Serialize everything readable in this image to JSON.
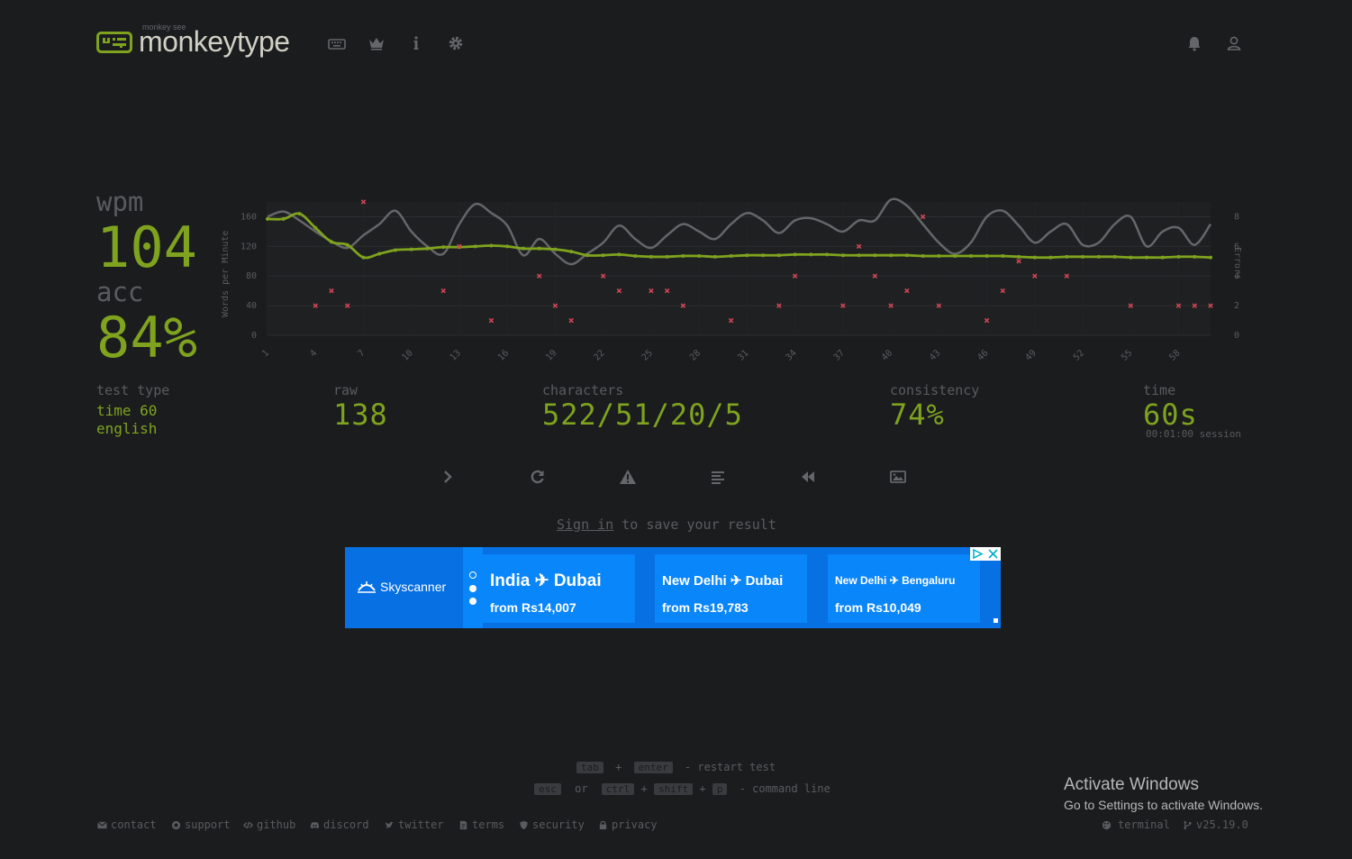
{
  "header": {
    "logo_small": "monkey see",
    "logo_text": "monkeytype",
    "nav_icons": [
      "keyboard-icon",
      "crown-icon",
      "info-icon",
      "gear-icon"
    ],
    "right_icons": [
      "bell-icon",
      "user-icon"
    ]
  },
  "result": {
    "wpm_label": "wpm",
    "wpm_value": "104",
    "acc_label": "acc",
    "acc_value": "84%",
    "test_type_label": "test type",
    "test_type_line1": "time 60",
    "test_type_line2": "english",
    "raw_label": "raw",
    "raw_value": "138",
    "characters_label": "characters",
    "characters_value": "522/51/20/5",
    "consistency_label": "consistency",
    "consistency_value": "74%",
    "time_label": "time",
    "time_value": "60s",
    "session_text": "00:01:00 session"
  },
  "chart_data": {
    "type": "line",
    "ylabel": "Words per Minute",
    "y2label": "Errors",
    "ylim": [
      0,
      180
    ],
    "y2lim": [
      0,
      9
    ],
    "yticks": [
      "160",
      "120",
      "80",
      "40",
      "0"
    ],
    "y2ticks": [
      "8",
      "6",
      "4",
      "2",
      "0"
    ],
    "xtick_labels": [
      "1",
      "4",
      "7",
      "10",
      "13",
      "16",
      "19",
      "22",
      "25",
      "28",
      "31",
      "34",
      "37",
      "40",
      "43",
      "46",
      "49",
      "52",
      "55",
      "58"
    ],
    "x": [
      1,
      2,
      3,
      4,
      5,
      6,
      7,
      8,
      9,
      10,
      11,
      12,
      13,
      14,
      15,
      16,
      17,
      18,
      19,
      20,
      21,
      22,
      23,
      24,
      25,
      26,
      27,
      28,
      29,
      30,
      31,
      32,
      33,
      34,
      35,
      36,
      37,
      38,
      39,
      40,
      41,
      42,
      43,
      44,
      45,
      46,
      47,
      48,
      49,
      50,
      51,
      52,
      53,
      54,
      55,
      56,
      57,
      58,
      59,
      60
    ],
    "series": [
      {
        "name": "wpm",
        "color": "#7fa31e",
        "values": [
          157,
          157,
          164,
          145,
          126,
          122,
          105,
          110,
          115,
          116,
          117,
          119,
          119,
          120,
          121,
          120,
          117,
          117,
          116,
          113,
          108,
          108,
          109,
          107,
          106,
          106,
          107,
          107,
          106,
          107,
          108,
          108,
          108,
          109,
          109,
          109,
          108,
          108,
          108,
          108,
          108,
          107,
          107,
          107,
          107,
          107,
          107,
          106,
          105,
          105,
          106,
          106,
          106,
          106,
          105,
          105,
          105,
          106,
          106,
          105
        ]
      },
      {
        "name": "raw",
        "color": "#646669",
        "values": [
          160,
          167,
          155,
          140,
          127,
          118,
          135,
          150,
          168,
          140,
          120,
          110,
          150,
          177,
          165,
          148,
          108,
          130,
          110,
          96,
          110,
          125,
          148,
          130,
          118,
          135,
          150,
          140,
          130,
          150,
          165,
          155,
          138,
          155,
          158,
          150,
          140,
          155,
          155,
          183,
          175,
          150,
          125,
          110,
          125,
          160,
          168,
          148,
          125,
          140,
          150,
          122,
          125,
          150,
          160,
          120,
          140,
          145,
          122,
          150
        ]
      },
      {
        "name": "errors",
        "color": "#ca4754",
        "points": [
          [
            4,
            2
          ],
          [
            5,
            3
          ],
          [
            6,
            2
          ],
          [
            7,
            9
          ],
          [
            12,
            3
          ],
          [
            13,
            6
          ],
          [
            15,
            1
          ],
          [
            18,
            4
          ],
          [
            19,
            2
          ],
          [
            20,
            1
          ],
          [
            22,
            4
          ],
          [
            23,
            3
          ],
          [
            25,
            3
          ],
          [
            26,
            3
          ],
          [
            27,
            2
          ],
          [
            30,
            1
          ],
          [
            33,
            2
          ],
          [
            34,
            4
          ],
          [
            37,
            2
          ],
          [
            38,
            6
          ],
          [
            39,
            4
          ],
          [
            40,
            2
          ],
          [
            41,
            3
          ],
          [
            42,
            8
          ],
          [
            43,
            2
          ],
          [
            46,
            1
          ],
          [
            47,
            3
          ],
          [
            48,
            5
          ],
          [
            49,
            4
          ],
          [
            51,
            4
          ],
          [
            55,
            2
          ],
          [
            58,
            2
          ],
          [
            59,
            2
          ],
          [
            60,
            2
          ]
        ]
      }
    ]
  },
  "actions": [
    "next-test",
    "restart-test",
    "show-words-history",
    "toggle-word-history",
    "watch-replay",
    "save-screenshot"
  ],
  "signin": {
    "link": "Sign in",
    "text": " to save your result"
  },
  "ad": {
    "brand": "Skyscanner",
    "cards": [
      {
        "route": "India ✈ Dubai",
        "price": "from Rs14,007"
      },
      {
        "route": "New Delhi ✈ Dubai",
        "price": "from Rs19,783"
      },
      {
        "route": "New Delhi ✈ Bengaluru",
        "price": "from Rs10,049"
      }
    ]
  },
  "shortcuts": {
    "tab": "tab",
    "plus1": "+",
    "enter": "enter",
    "restart": "- restart test",
    "esc": "esc",
    "or": "or",
    "ctrl": "ctrl",
    "plus2": "+",
    "shift": "shift",
    "plus3": "+",
    "p": "p",
    "command": "- command line"
  },
  "footer": {
    "contact": "contact",
    "support": "support",
    "github": "github",
    "discord": "discord",
    "twitter": "twitter",
    "terms": "terms",
    "security": "security",
    "privacy": "privacy",
    "theme": "terminal",
    "version": "v25.19.0"
  },
  "windows": {
    "title": "Activate Windows",
    "subtitle": "Go to Settings to activate Windows."
  }
}
